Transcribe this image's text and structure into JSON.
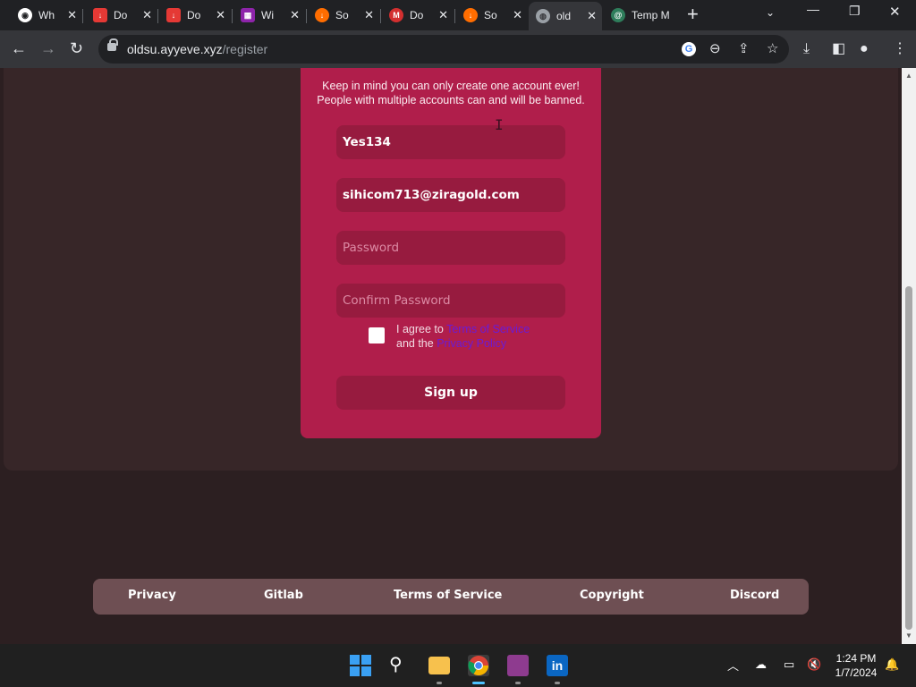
{
  "browser": {
    "tabs": [
      {
        "label": "Wh",
        "icon": "chrome-icon",
        "color": "#4285f4"
      },
      {
        "label": "Do",
        "icon": "download-icon",
        "color": "#e53935"
      },
      {
        "label": "Do",
        "icon": "download-icon",
        "color": "#e53935"
      },
      {
        "label": "Wi",
        "icon": "winrar-icon",
        "color": "#8e24aa"
      },
      {
        "label": "So",
        "icon": "sourceforge-icon",
        "color": "#ff6d00"
      },
      {
        "label": "Do",
        "icon": "mega-icon",
        "color": "#d32f2f"
      },
      {
        "label": "So",
        "icon": "sourceforge-icon",
        "color": "#ff6d00"
      },
      {
        "label": "old",
        "icon": "globe-icon",
        "color": "#9aa0a6"
      },
      {
        "label": "Temp M",
        "icon": "tempmail-icon",
        "color": "#2e7d5b"
      }
    ],
    "url_domain": "oldsu.ayyeve.xyz",
    "url_path": "/register"
  },
  "register": {
    "notice_line1": "Keep in mind you can only create one account ever!",
    "notice_line2": "People with multiple accounts can and will be banned.",
    "username_value": "Yes134",
    "email_value": "sihicom713@ziragold.com",
    "password_placeholder": "Password",
    "confirm_placeholder": "Confirm Password",
    "agree_prefix": "I agree to",
    "terms_link": "Terms of Service",
    "and_the": "and the",
    "privacy_link": "Privacy Policy",
    "signup_label": "Sign up"
  },
  "footer": {
    "links": [
      "Privacy",
      "Gitlab",
      "Terms of Service",
      "Copyright",
      "Discord"
    ]
  },
  "taskbar": {
    "time": "1:24 PM",
    "date": "1/7/2024"
  }
}
